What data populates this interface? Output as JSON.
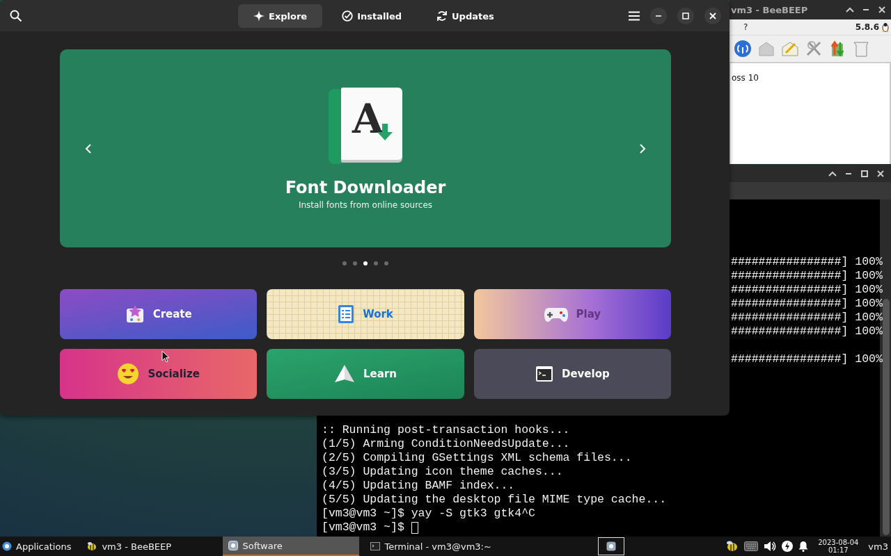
{
  "software_window": {
    "tabs": [
      {
        "label": "Explore",
        "selected": true,
        "kind": "explore"
      },
      {
        "label": "Installed",
        "selected": false,
        "kind": "installed"
      },
      {
        "label": "Updates",
        "selected": false,
        "kind": "updates"
      }
    ],
    "carousel": {
      "app_icon_letter": "A",
      "title": "Font Downloader",
      "subtitle": "Install fonts from online sources",
      "pages": [
        {
          "selected": false
        },
        {
          "selected": false
        },
        {
          "selected": true
        },
        {
          "selected": false
        },
        {
          "selected": false
        }
      ]
    },
    "categories": [
      {
        "label": "Create",
        "kind": "create"
      },
      {
        "label": "Work",
        "kind": "work"
      },
      {
        "label": "Play",
        "kind": "play"
      },
      {
        "label": "Socialize",
        "kind": "socialize"
      },
      {
        "label": "Learn",
        "kind": "learn"
      },
      {
        "label": "Develop",
        "kind": "develop"
      }
    ]
  },
  "beebeep_window": {
    "title": "vm3 - BeeBEEP",
    "menu": [
      "?"
    ],
    "version": "5.8.6",
    "chat_line": "oss 10"
  },
  "terminal_window": {
    "progress_lines": [
      "################] 100%",
      "################] 100%",
      "################] 100%",
      "################] 100%",
      "################] 100%",
      "################] 100%"
    ],
    "progress_lines_after_gap": [
      "################] 100%"
    ],
    "lines": [
      ":: Running post-transaction hooks...",
      "(1/5) Arming ConditionNeedsUpdate...",
      "(2/5) Compiling GSettings XML schema files...",
      "(3/5) Updating icon theme caches...",
      "(4/5) Updating BAMF index...",
      "(5/5) Updating the desktop file MIME type cache...",
      "[vm3@vm3 ~]$ yay -S gtk3 gtk4^C"
    ],
    "prompt": "[vm3@vm3 ~]$"
  },
  "taskbar": {
    "menu_label": "Applications",
    "tasks": [
      {
        "label": "vm3 - BeeBEEP",
        "selected": false,
        "kind": "bee"
      },
      {
        "label": "Software",
        "selected": true,
        "kind": "software"
      },
      {
        "label": "Terminal - vm3@vm3:~",
        "selected": false,
        "kind": "terminal"
      }
    ],
    "date": "2023-08-04",
    "time": "01:17",
    "user": "vm3"
  }
}
